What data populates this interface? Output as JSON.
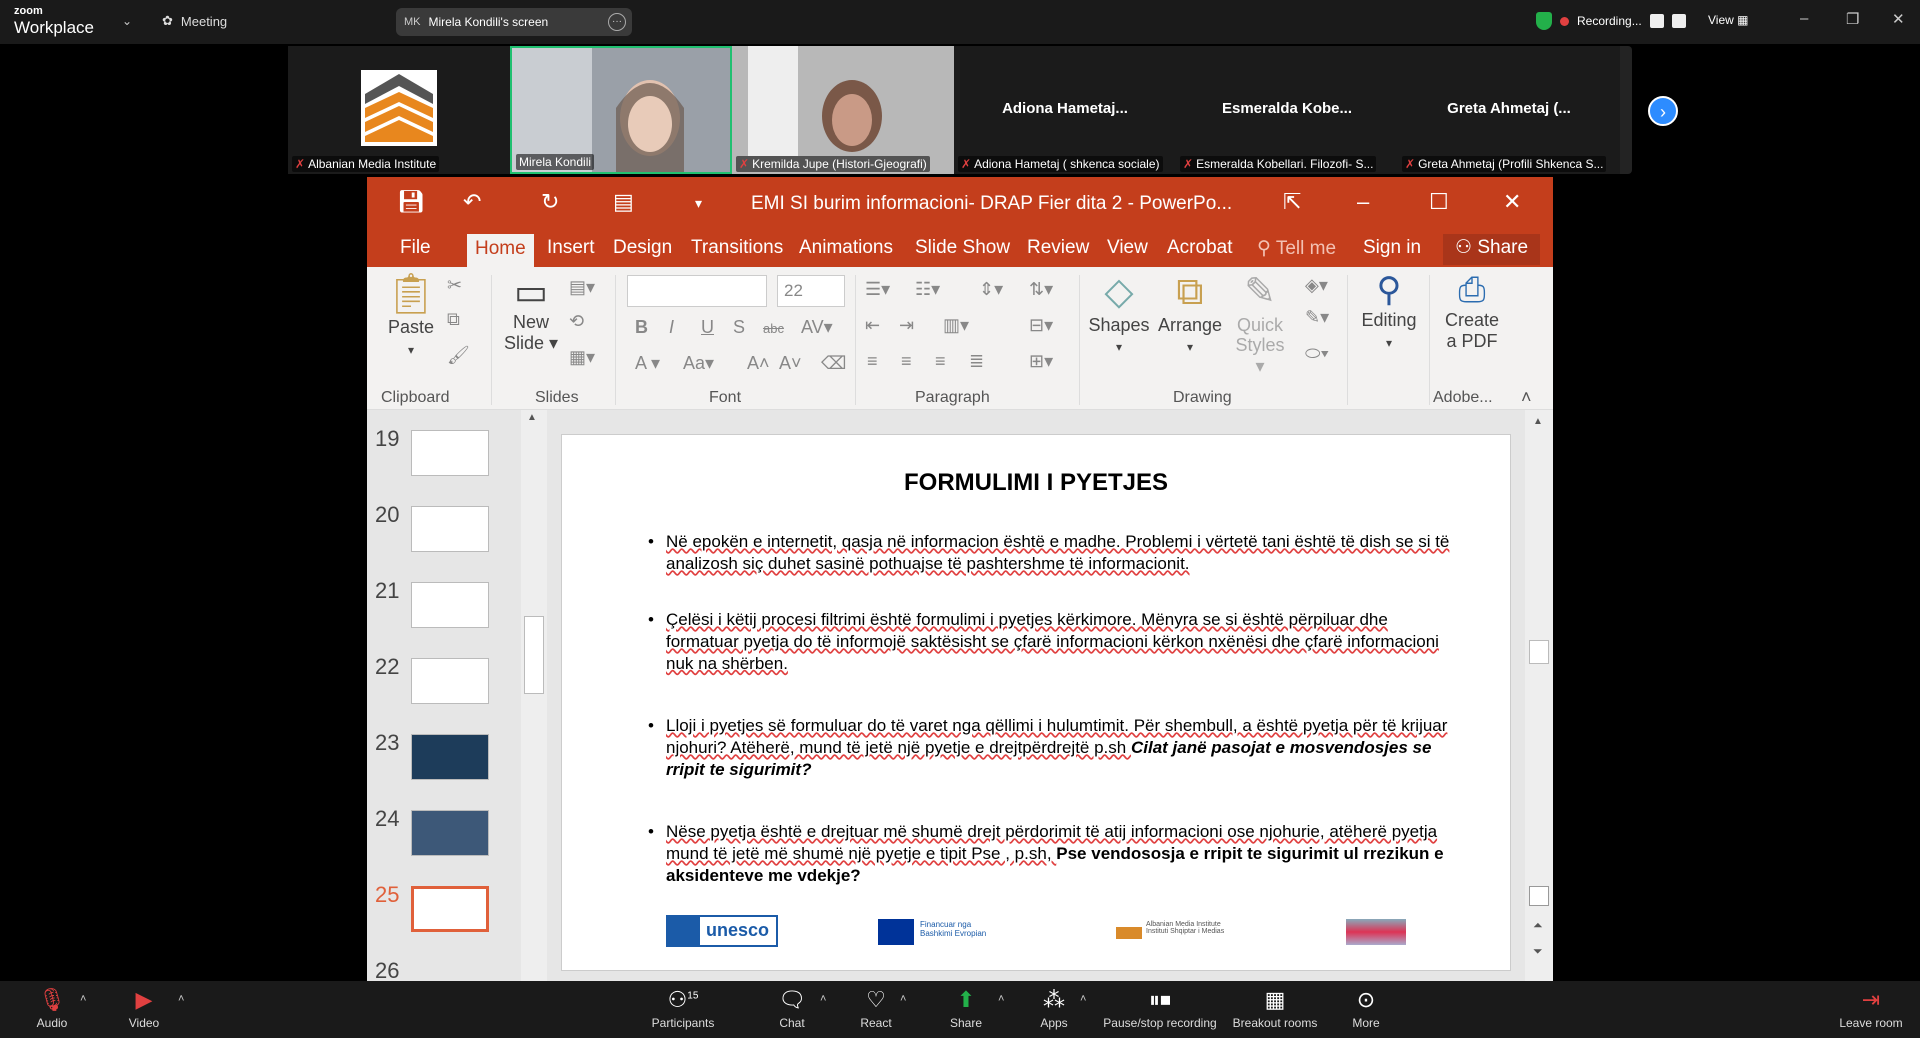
{
  "zoom": {
    "brand_small": "zoom",
    "brand_big": "Workplace",
    "meeting_label": "Meeting",
    "screen_initials": "MK",
    "screen_label": "Mirela Kondili's screen",
    "recording_label": "Recording...",
    "view_label": "View",
    "win_min": "–",
    "win_max": "❐",
    "win_close": "✕"
  },
  "participants": [
    {
      "label": "Albanian Media Institute",
      "big": ""
    },
    {
      "label": "Mirela Kondili",
      "big": ""
    },
    {
      "label": "Kremilda Jupe (Histori-Gjeografi)",
      "big": ""
    },
    {
      "label": "Adiona Hametaj ( shkenca sociale)",
      "big": "Adiona  Hametaj..."
    },
    {
      "label": "Esmeralda Kobellari. Filozofi- S...",
      "big": "Esmeralda  Kobe..."
    },
    {
      "label": "Greta Ahmetaj (Profili Shkenca S...",
      "big": "Greta Ahmetaj (..."
    }
  ],
  "ppt": {
    "title": "EMI  SI burim informacioni- DRAP Fier dita 2 - PowerPo...",
    "tabs": [
      "File",
      "Home",
      "Insert",
      "Design",
      "Transitions",
      "Animations",
      "Slide Show",
      "Review",
      "View",
      "Acrobat",
      "Tell me",
      "Sign in",
      "Share"
    ],
    "ribbon": {
      "paste": "Paste",
      "new_slide_1": "New",
      "new_slide_2": "Slide",
      "font_size": "22",
      "shapes": "Shapes",
      "arrange": "Arrange",
      "quick_1": "Quick",
      "quick_2": "Styles",
      "editing": "Editing",
      "pdf_1": "Create",
      "pdf_2": "a PDF",
      "groups": [
        "Clipboard",
        "Slides",
        "Font",
        "Paragraph",
        "Drawing",
        "Adobe..."
      ]
    },
    "thumbs": [
      "19",
      "20",
      "21",
      "22",
      "23",
      "24",
      "25",
      "26"
    ],
    "slide": {
      "title": "FORMULIMI I PYETJES",
      "bullets": [
        {
          "text": "Në epokën e internetit, qasja në informacion është e madhe. Problemi i vërtetë tani është të dish se si të analizosh siç duhet sasinë pothuajse të pashtershme të informacionit.",
          "bold": ""
        },
        {
          "text": "Çelësi i këtij procesi filtrimi është formulimi i pyetjes kërkimore. Mënyra se si është përpiluar dhe formatuar pyetja do të informojë saktësisht se çfarë informacioni kërkon nxënësi dhe çfarë informacioni  nuk na shërben.",
          "bold": ""
        },
        {
          "text": "Lloji i pyetjes së formuluar do të varet nga qëllimi i hulumtimit. Për shembull, a është pyetja për të krijuar njohuri? Atëherë, mund të jetë një pyetje e drejtpërdrejtë p.sh ",
          "bold": "Cilat janë pasojat e  mosvendosjes se rripit te sigurimit?"
        },
        {
          "text": "Nëse pyetja është e drejtuar më shumë drejt përdorimit të atij informacioni ose njohurie, atëherë pyetja mund të jetë më shumë një pyetje e tipit Pse , p.sh, ",
          "bold": "Pse vendososja e rripit te sigurimit ul rrezikun e aksidenteve me vdekje?"
        }
      ],
      "logo_unesco": "unesco",
      "logo_eu_1": "Financuar nga",
      "logo_eu_2": "Bashkimi Evropian",
      "logo_ami": "Albanian Media Institute Instituti Shqiptar i Medias"
    }
  },
  "bottom": {
    "audio": "Audio",
    "video": "Video",
    "participants": "Participants",
    "participants_count": "15",
    "chat": "Chat",
    "react": "React",
    "share": "Share",
    "apps": "Apps",
    "pause": "Pause/stop recording",
    "breakout": "Breakout rooms",
    "more": "More",
    "leave": "Leave room"
  }
}
